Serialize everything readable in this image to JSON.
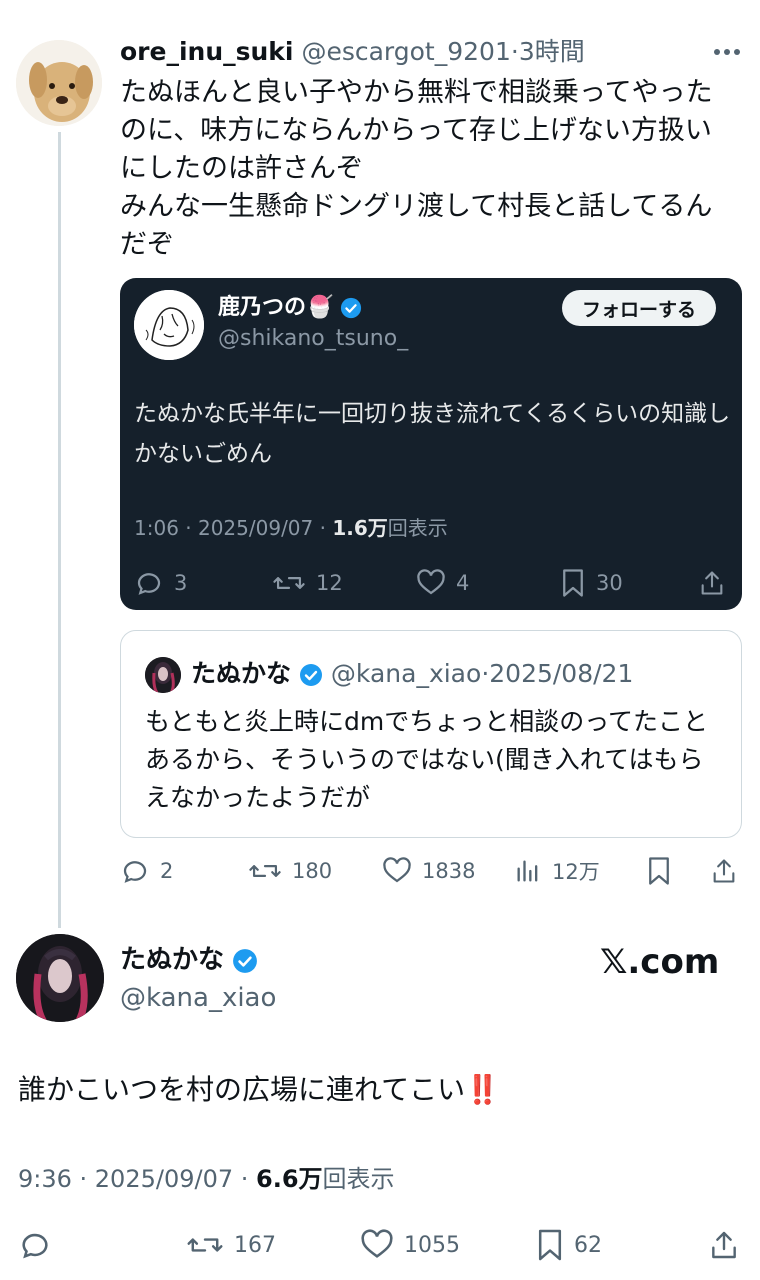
{
  "reply": {
    "display_name": "ore_inu_suki",
    "handle": "@escargot_9201",
    "time": "3時間",
    "text": "たぬほんと良い子やから無料で相談乗ってやったのに、味方にならんからって存じ上げない方扱いにしたのは許さんぞ\nみんな一生懸命ドングリ渡して村長と話してるんだぞ",
    "embedded_post": {
      "display_name": "鹿乃つの",
      "name_emoji": "🍧",
      "handle": "@shikano_tsuno_",
      "follow_label": "フォローする",
      "text": "たぬかな氏半年に一回切り抜き流れてくるくらいの知識しかないごめん",
      "meta_time": "1:06 · 2025/09/07 · ",
      "views_count": "1.6万",
      "views_label": "回表示",
      "replies": "3",
      "reposts": "12",
      "likes": "4",
      "bookmarks": "30"
    },
    "quoted_post": {
      "display_name": "たぬかな",
      "handle": "@kana_xiao",
      "date": "2025/08/21",
      "text": "もともと炎上時にdmでちょっと相談のってたことあるから、そういうのではない(聞き入れてはもらえなかったようだが"
    },
    "actions": {
      "replies": "2",
      "reposts": "180",
      "likes": "1838",
      "views": "12万"
    }
  },
  "main": {
    "display_name": "たぬかな",
    "handle": "@kana_xiao",
    "watermark": "𝕏.com",
    "text": "誰かこいつを村の広場に連れてこい",
    "text_emoji": "‼️",
    "meta_time": "9:36 · 2025/09/07 · ",
    "views_count": "6.6万",
    "views_label": "回表示",
    "actions": {
      "replies": "",
      "reposts": "167",
      "likes": "1055",
      "bookmarks": "62"
    }
  },
  "colors": {
    "verified": "#1d9bf0",
    "muted": "#536471",
    "dark_card": "#15202b",
    "emoji_red": "#e0245e"
  }
}
